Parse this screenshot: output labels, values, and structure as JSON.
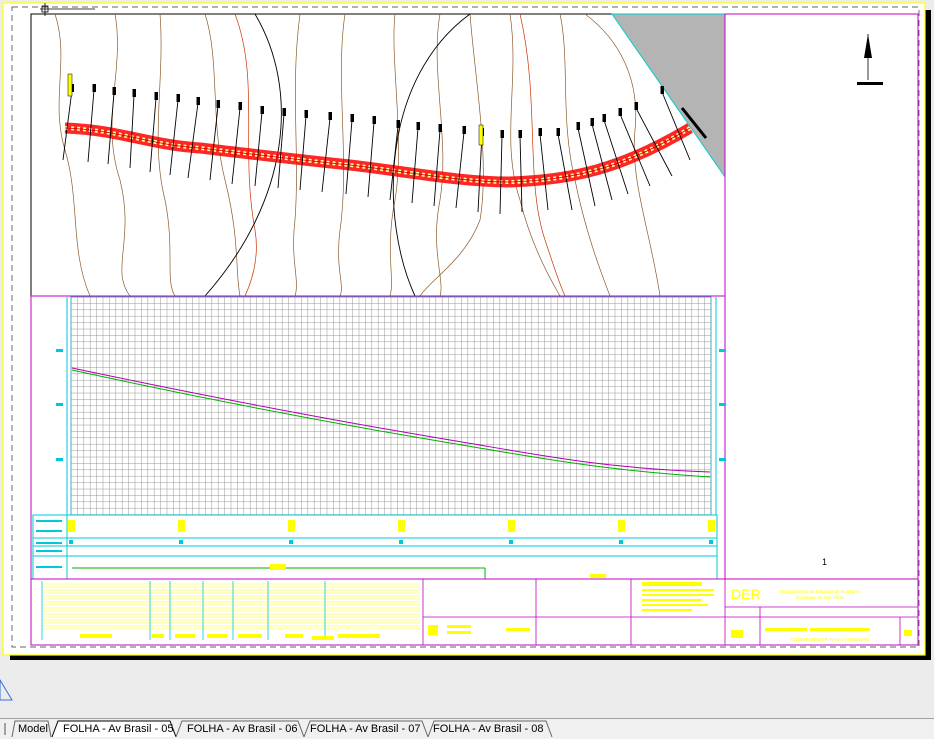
{
  "tabs": [
    {
      "label": "Model",
      "active": false
    },
    {
      "label": "FOLHA - Av Brasil - 05",
      "active": true
    },
    {
      "label": "FOLHA - Av Brasil - 06",
      "active": false
    },
    {
      "label": "FOLHA - Av Brasil - 07",
      "active": false
    },
    {
      "label": "FOLHA - Av Brasil - 08",
      "active": false
    }
  ],
  "drawing": {
    "sheet_number": "1",
    "logo": "DER",
    "org_line1": "Departamento de Estradas de Rodagem",
    "org_line2": "do Estado de São Paulo",
    "code_label": "CÓDIGO DO DER PARA O DESENHO"
  },
  "colors": {
    "paper": "#ffffff",
    "border_yellow": "#ffff00",
    "frame_magenta": "#c000c0",
    "grid_cyan": "#00c8d8",
    "road_red": "#ff0000",
    "contour_brown": "#8b5a2b",
    "profile_green": "#00b000",
    "profile_magenta": "#b000b0"
  }
}
